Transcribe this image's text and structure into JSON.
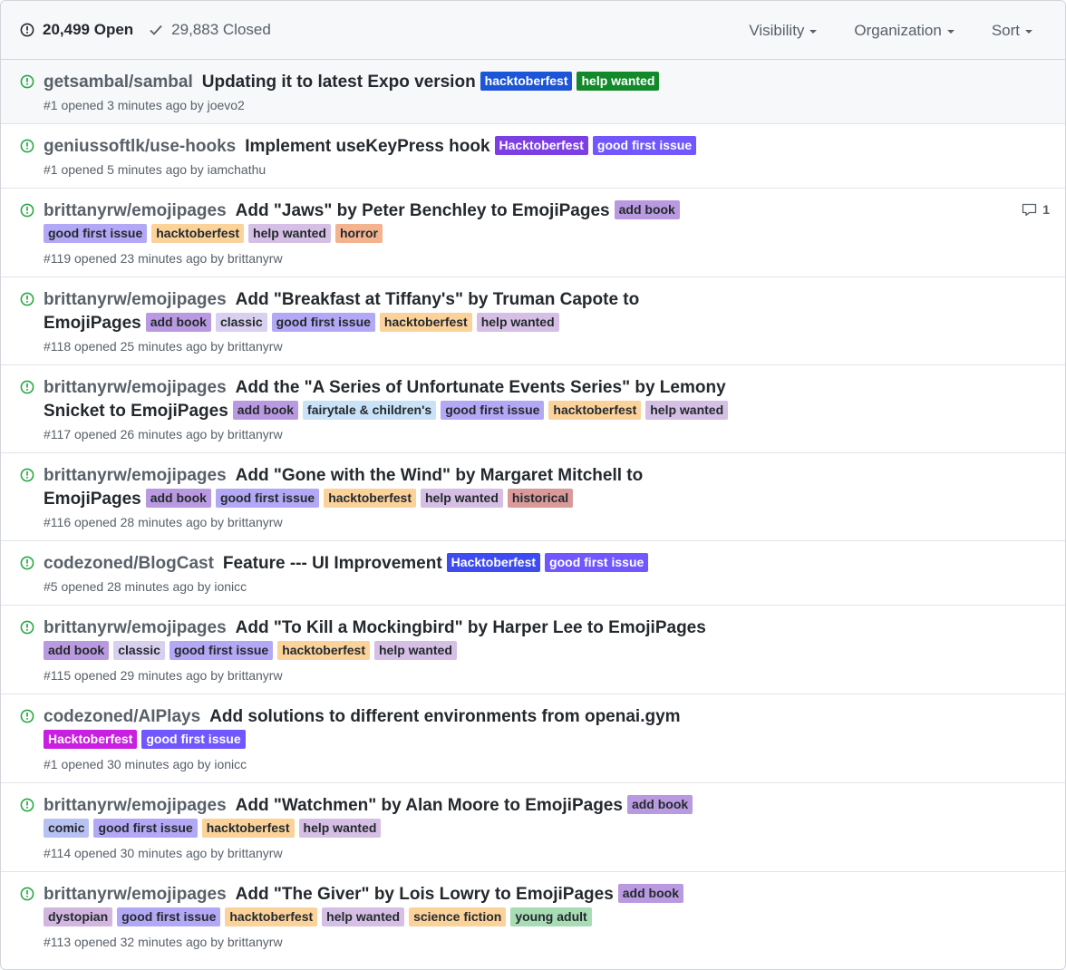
{
  "header": {
    "open_label": "20,499 Open",
    "closed_label": "29,883 Closed",
    "filters": [
      "Visibility",
      "Organization",
      "Sort"
    ]
  },
  "colors": {
    "open_icon": "#28a745",
    "muted": "#586069"
  },
  "issues": [
    {
      "repo": "getsambal/sambal",
      "title": "Updating it to latest Expo version",
      "meta": "#1 opened 3 minutes ago by joevo2",
      "highlighted": true,
      "inline_labels": [
        {
          "name": "hacktoberfest",
          "bg": "#1d55d8",
          "fg": "#ffffff"
        },
        {
          "name": "help wanted",
          "bg": "#138a2a",
          "fg": "#ffffff"
        }
      ],
      "labels": []
    },
    {
      "repo": "geniussoftlk/use-hooks",
      "title": "Implement useKeyPress hook",
      "meta": "#1 opened 5 minutes ago by iamchathu",
      "inline_labels": [
        {
          "name": "Hacktoberfest",
          "bg": "#7b3fe4",
          "fg": "#ffffff"
        },
        {
          "name": "good first issue",
          "bg": "#7057ff",
          "fg": "#ffffff"
        }
      ],
      "labels": []
    },
    {
      "repo": "brittanyrw/emojipages",
      "title": "Add \"Jaws\" by Peter Benchley to EmojiPages",
      "meta": "#119 opened 23 minutes ago by brittanyrw",
      "comments": "1",
      "inline_labels": [
        {
          "name": "add book",
          "bg": "#b99ae0",
          "fg": "#24292e"
        }
      ],
      "labels": [
        {
          "name": "good first issue",
          "bg": "#b3a8f5",
          "fg": "#24292e"
        },
        {
          "name": "hacktoberfest",
          "bg": "#fbd39a",
          "fg": "#24292e"
        },
        {
          "name": "help wanted",
          "bg": "#d5bfe4",
          "fg": "#24292e"
        },
        {
          "name": "horror",
          "bg": "#f4b38f",
          "fg": "#24292e"
        }
      ]
    },
    {
      "repo": "brittanyrw/emojipages",
      "title": "Add \"Breakfast at Tiffany's\" by Truman Capote to EmojiPages",
      "meta": "#118 opened 25 minutes ago by brittanyrw",
      "inline_labels": [
        {
          "name": "add book",
          "bg": "#b99ae0",
          "fg": "#24292e"
        },
        {
          "name": "classic",
          "bg": "#d9d0f0",
          "fg": "#24292e"
        },
        {
          "name": "good first issue",
          "bg": "#b3a8f5",
          "fg": "#24292e"
        },
        {
          "name": "hacktoberfest",
          "bg": "#fbd39a",
          "fg": "#24292e"
        },
        {
          "name": "help wanted",
          "bg": "#d5bfe4",
          "fg": "#24292e"
        }
      ],
      "labels": []
    },
    {
      "repo": "brittanyrw/emojipages",
      "title": "Add the \"A Series of Unfortunate Events Series\" by Lemony Snicket to EmojiPages",
      "meta": "#117 opened 26 minutes ago by brittanyrw",
      "inline_labels": [
        {
          "name": "add book",
          "bg": "#b99ae0",
          "fg": "#24292e"
        },
        {
          "name": "fairytale & children's",
          "bg": "#c9e2f7",
          "fg": "#24292e"
        },
        {
          "name": "good first issue",
          "bg": "#b3a8f5",
          "fg": "#24292e"
        },
        {
          "name": "hacktoberfest",
          "bg": "#fbd39a",
          "fg": "#24292e"
        },
        {
          "name": "help wanted",
          "bg": "#d5bfe4",
          "fg": "#24292e"
        }
      ],
      "labels": []
    },
    {
      "repo": "brittanyrw/emojipages",
      "title": "Add \"Gone with the Wind\" by Margaret Mitchell to EmojiPages",
      "meta": "#116 opened 28 minutes ago by brittanyrw",
      "inline_labels": [
        {
          "name": "add book",
          "bg": "#b99ae0",
          "fg": "#24292e"
        },
        {
          "name": "good first issue",
          "bg": "#b3a8f5",
          "fg": "#24292e"
        },
        {
          "name": "hacktoberfest",
          "bg": "#fbd39a",
          "fg": "#24292e"
        },
        {
          "name": "help wanted",
          "bg": "#d5bfe4",
          "fg": "#24292e"
        },
        {
          "name": "historical",
          "bg": "#d99a99",
          "fg": "#24292e"
        }
      ],
      "labels": []
    },
    {
      "repo": "codezoned/BlogCast",
      "title": "Feature --- UI Improvement",
      "meta": "#5 opened 28 minutes ago by ionicc",
      "inline_labels": [
        {
          "name": "Hacktoberfest",
          "bg": "#3e4bf0",
          "fg": "#ffffff"
        },
        {
          "name": "good first issue",
          "bg": "#7057ff",
          "fg": "#ffffff"
        }
      ],
      "labels": []
    },
    {
      "repo": "brittanyrw/emojipages",
      "title": "Add \"To Kill a Mockingbird\" by Harper Lee to EmojiPages",
      "meta": "#115 opened 29 minutes ago by brittanyrw",
      "inline_labels": [],
      "labels": [
        {
          "name": "add book",
          "bg": "#b99ae0",
          "fg": "#24292e"
        },
        {
          "name": "classic",
          "bg": "#d9d0f0",
          "fg": "#24292e"
        },
        {
          "name": "good first issue",
          "bg": "#b3a8f5",
          "fg": "#24292e"
        },
        {
          "name": "hacktoberfest",
          "bg": "#fbd39a",
          "fg": "#24292e"
        },
        {
          "name": "help wanted",
          "bg": "#d5bfe4",
          "fg": "#24292e"
        }
      ]
    },
    {
      "repo": "codezoned/AIPlays",
      "title": "Add solutions to different environments from openai.gym",
      "meta": "#1 opened 30 minutes ago by ionicc",
      "inline_labels": [],
      "labels": [
        {
          "name": "Hacktoberfest",
          "bg": "#c81fe0",
          "fg": "#ffffff"
        },
        {
          "name": "good first issue",
          "bg": "#7057ff",
          "fg": "#ffffff"
        }
      ]
    },
    {
      "repo": "brittanyrw/emojipages",
      "title": "Add \"Watchmen\" by Alan Moore to EmojiPages",
      "meta": "#114 opened 30 minutes ago by brittanyrw",
      "inline_labels": [
        {
          "name": "add book",
          "bg": "#b99ae0",
          "fg": "#24292e"
        }
      ],
      "labels": [
        {
          "name": "comic",
          "bg": "#b8c2f2",
          "fg": "#24292e"
        },
        {
          "name": "good first issue",
          "bg": "#b3a8f5",
          "fg": "#24292e"
        },
        {
          "name": "hacktoberfest",
          "bg": "#fbd39a",
          "fg": "#24292e"
        },
        {
          "name": "help wanted",
          "bg": "#d5bfe4",
          "fg": "#24292e"
        }
      ]
    },
    {
      "repo": "brittanyrw/emojipages",
      "title": "Add \"The Giver\" by Lois Lowry to EmojiPages",
      "meta": "#113 opened 32 minutes ago by brittanyrw",
      "inline_labels": [
        {
          "name": "add book",
          "bg": "#b99ae0",
          "fg": "#24292e"
        }
      ],
      "labels": [
        {
          "name": "dystopian",
          "bg": "#d2b6e0",
          "fg": "#24292e"
        },
        {
          "name": "good first issue",
          "bg": "#b3a8f5",
          "fg": "#24292e"
        },
        {
          "name": "hacktoberfest",
          "bg": "#fbd39a",
          "fg": "#24292e"
        },
        {
          "name": "help wanted",
          "bg": "#d5bfe4",
          "fg": "#24292e"
        },
        {
          "name": "science fiction",
          "bg": "#fbd39a",
          "fg": "#24292e"
        },
        {
          "name": "young adult",
          "bg": "#a8dcb4",
          "fg": "#24292e"
        }
      ]
    }
  ]
}
